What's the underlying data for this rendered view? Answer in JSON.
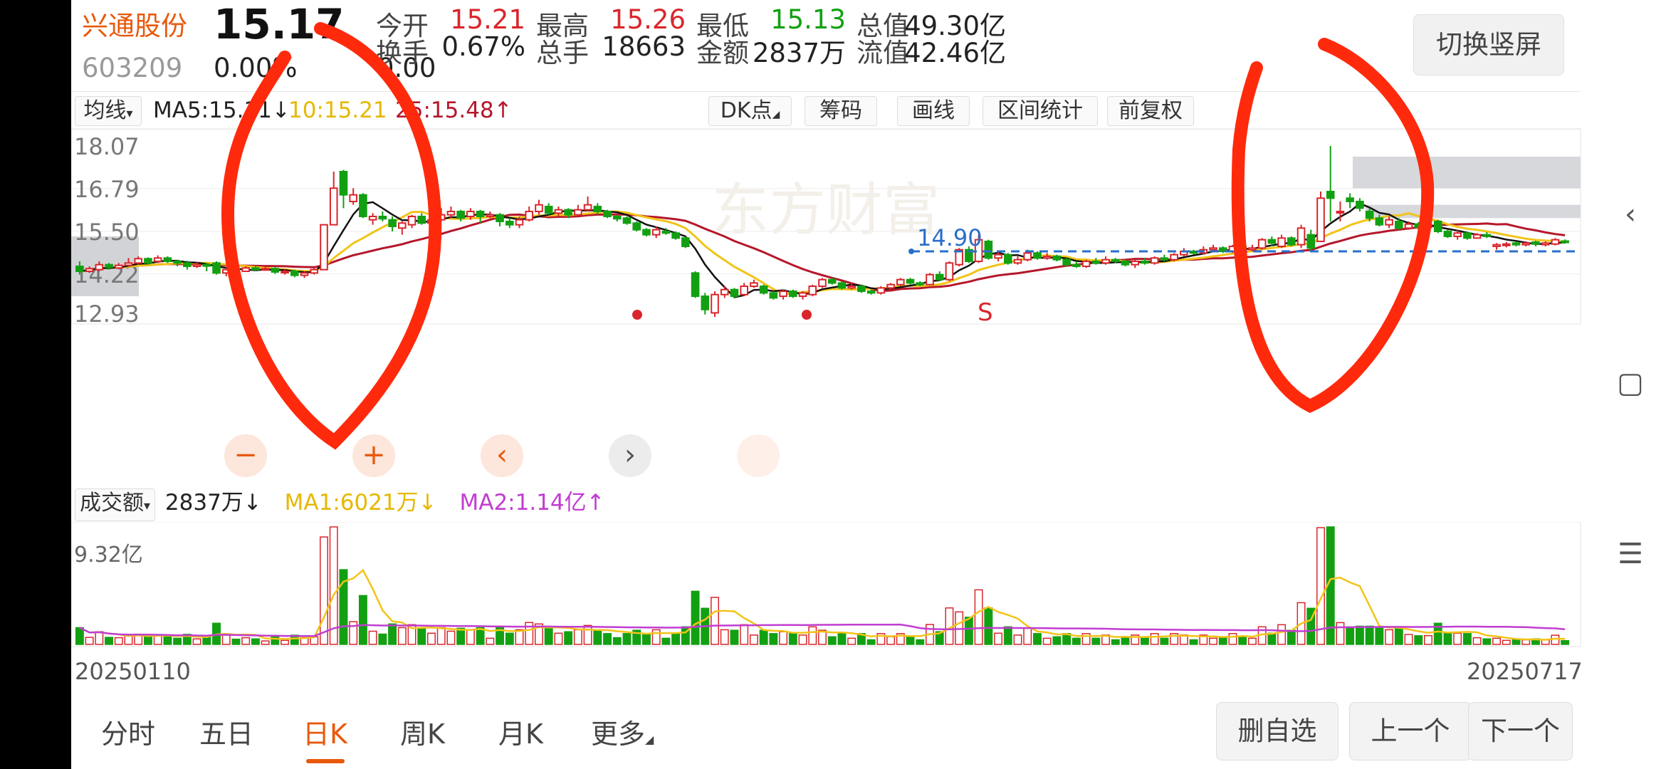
{
  "quote": {
    "name": "兴通股份",
    "price": "15.17",
    "code": "603209",
    "change_pct": "0.00%",
    "change_amt": "0.00",
    "stats": [
      {
        "label": "今开",
        "value": "15.21",
        "color": "#d9262c"
      },
      {
        "label": "最高",
        "value": "15.26",
        "color": "#d9262c"
      },
      {
        "label": "最低",
        "value": "15.13",
        "color": "#12a012"
      },
      {
        "label": "总值",
        "value": "49.30亿",
        "color": "#222222"
      },
      {
        "label": "换手",
        "value": "0.67%",
        "color": "#222222"
      },
      {
        "label": "总手",
        "value": "18663",
        "color": "#222222"
      },
      {
        "label": "金额",
        "value": "2837万",
        "color": "#222222"
      },
      {
        "label": "流值",
        "value": "42.46亿",
        "color": "#222222"
      }
    ],
    "switch_label": "切换竖屏"
  },
  "toolbar": {
    "ma_selector": "均线",
    "ma5": "MA5:15.11↓",
    "ma10": "10:15.21",
    "ma20": "25:15.48↑",
    "buttons": [
      "DK点",
      "筹码",
      "画线",
      "区间统计",
      "前复权"
    ]
  },
  "kchart": {
    "y_labels": [
      "18.07",
      "16.79",
      "15.50",
      "14.22",
      "12.93"
    ],
    "support_line_label": "14.90",
    "signal_label": "S",
    "watermark": "东方财富"
  },
  "volume": {
    "selector": "成交额",
    "amount": "2837万↓",
    "ma1": "MA1:6021万↓",
    "ma2": "MA2:1.14亿↑",
    "max_label": "9.32亿",
    "date_start": "20250110",
    "date_end": "20250717"
  },
  "controls": [
    "−",
    "+",
    "‹",
    "›"
  ],
  "tabs": [
    "分时",
    "五日",
    "日K",
    "周K",
    "月K",
    "更多"
  ],
  "active_tab": "日K",
  "bottom_buttons": [
    "删自选",
    "上一个",
    "下一个"
  ],
  "colors": {
    "up": "#d9262c",
    "down": "#12a012",
    "accent": "#e8590c",
    "ma_black": "#111111",
    "ma_yellow": "#f2c418",
    "ma_red": "#b5172b",
    "ma_magenta": "#c13dd1"
  },
  "chart_data": {
    "type": "candlestick",
    "y_range": [
      12.93,
      18.07
    ],
    "candles": [
      {
        "o": 14.45,
        "c": 14.3,
        "h": 14.6,
        "l": 14.2
      },
      {
        "o": 14.3,
        "c": 14.38,
        "h": 14.45,
        "l": 14.25
      },
      {
        "o": 14.35,
        "c": 14.5,
        "h": 14.6,
        "l": 14.3
      },
      {
        "o": 14.5,
        "c": 14.42,
        "h": 14.55,
        "l": 14.35
      },
      {
        "o": 14.4,
        "c": 14.48,
        "h": 14.55,
        "l": 14.36
      },
      {
        "o": 14.48,
        "c": 14.55,
        "h": 14.7,
        "l": 14.45
      },
      {
        "o": 14.55,
        "c": 14.68,
        "h": 14.75,
        "l": 14.5
      },
      {
        "o": 14.68,
        "c": 14.55,
        "h": 14.72,
        "l": 14.5
      },
      {
        "o": 14.6,
        "c": 14.7,
        "h": 14.78,
        "l": 14.55
      },
      {
        "o": 14.7,
        "c": 14.6,
        "h": 14.75,
        "l": 14.55
      },
      {
        "o": 14.6,
        "c": 14.55,
        "h": 14.65,
        "l": 14.45
      },
      {
        "o": 14.55,
        "c": 14.45,
        "h": 14.62,
        "l": 14.35
      },
      {
        "o": 14.45,
        "c": 14.5,
        "h": 14.58,
        "l": 14.4
      },
      {
        "o": 14.5,
        "c": 14.48,
        "h": 14.55,
        "l": 14.3
      },
      {
        "o": 14.55,
        "c": 14.25,
        "h": 14.6,
        "l": 14.2
      },
      {
        "o": 14.25,
        "c": 14.35,
        "h": 14.4,
        "l": 14.15
      },
      {
        "o": 14.35,
        "c": 14.3,
        "h": 14.42,
        "l": 14.25
      },
      {
        "o": 14.3,
        "c": 14.4,
        "h": 14.45,
        "l": 14.28
      },
      {
        "o": 14.4,
        "c": 14.35,
        "h": 14.48,
        "l": 14.3
      },
      {
        "o": 14.35,
        "c": 14.38,
        "h": 14.45,
        "l": 14.32
      },
      {
        "o": 14.38,
        "c": 14.28,
        "h": 14.42,
        "l": 14.22
      },
      {
        "o": 14.28,
        "c": 14.3,
        "h": 14.36,
        "l": 14.2
      },
      {
        "o": 14.3,
        "c": 14.18,
        "h": 14.35,
        "l": 14.12
      },
      {
        "o": 14.18,
        "c": 14.25,
        "h": 14.3,
        "l": 14.1
      },
      {
        "o": 14.25,
        "c": 14.35,
        "h": 14.4,
        "l": 14.2
      },
      {
        "o": 14.35,
        "c": 15.7,
        "h": 15.7,
        "l": 14.35
      },
      {
        "o": 15.7,
        "c": 16.8,
        "h": 17.3,
        "l": 15.7
      },
      {
        "o": 17.3,
        "c": 16.6,
        "h": 17.35,
        "l": 16.2
      },
      {
        "o": 16.4,
        "c": 16.6,
        "h": 16.8,
        "l": 16.3
      },
      {
        "o": 16.6,
        "c": 15.95,
        "h": 16.65,
        "l": 15.9
      },
      {
        "o": 15.85,
        "c": 15.95,
        "h": 16.05,
        "l": 15.7
      },
      {
        "o": 15.95,
        "c": 15.88,
        "h": 16.1,
        "l": 15.8
      },
      {
        "o": 15.85,
        "c": 15.65,
        "h": 15.95,
        "l": 15.5
      },
      {
        "o": 15.6,
        "c": 15.75,
        "h": 15.8,
        "l": 15.4
      },
      {
        "o": 15.7,
        "c": 15.95,
        "h": 16.0,
        "l": 15.6
      },
      {
        "o": 15.95,
        "c": 15.75,
        "h": 16.05,
        "l": 15.7
      },
      {
        "o": 15.75,
        "c": 15.85,
        "h": 16.0,
        "l": 15.7
      },
      {
        "o": 15.85,
        "c": 16.0,
        "h": 16.2,
        "l": 15.8
      },
      {
        "o": 16.0,
        "c": 16.1,
        "h": 16.25,
        "l": 15.9
      },
      {
        "o": 16.1,
        "c": 15.9,
        "h": 16.15,
        "l": 15.8
      },
      {
        "o": 15.95,
        "c": 16.1,
        "h": 16.2,
        "l": 15.85
      },
      {
        "o": 16.1,
        "c": 15.95,
        "h": 16.15,
        "l": 15.75
      },
      {
        "o": 15.95,
        "c": 16.0,
        "h": 16.1,
        "l": 15.9
      },
      {
        "o": 16.0,
        "c": 15.8,
        "h": 16.05,
        "l": 15.65
      },
      {
        "o": 15.8,
        "c": 15.7,
        "h": 15.9,
        "l": 15.6
      },
      {
        "o": 15.7,
        "c": 15.85,
        "h": 15.95,
        "l": 15.6
      },
      {
        "o": 15.85,
        "c": 16.1,
        "h": 16.25,
        "l": 15.8
      },
      {
        "o": 16.1,
        "c": 16.3,
        "h": 16.45,
        "l": 16.0
      },
      {
        "o": 16.25,
        "c": 16.05,
        "h": 16.35,
        "l": 16.0
      },
      {
        "o": 16.05,
        "c": 16.15,
        "h": 16.25,
        "l": 15.95
      },
      {
        "o": 16.15,
        "c": 16.0,
        "h": 16.2,
        "l": 15.9
      },
      {
        "o": 16.0,
        "c": 16.15,
        "h": 16.3,
        "l": 15.95
      },
      {
        "o": 16.15,
        "c": 16.3,
        "h": 16.55,
        "l": 16.1
      },
      {
        "o": 16.25,
        "c": 16.1,
        "h": 16.35,
        "l": 16.0
      },
      {
        "o": 16.1,
        "c": 15.95,
        "h": 16.15,
        "l": 15.9
      },
      {
        "o": 15.95,
        "c": 15.88,
        "h": 16.0,
        "l": 15.8
      },
      {
        "o": 15.9,
        "c": 15.75,
        "h": 15.95,
        "l": 15.7
      },
      {
        "o": 15.75,
        "c": 15.55,
        "h": 15.8,
        "l": 15.5
      },
      {
        "o": 15.55,
        "c": 15.4,
        "h": 15.6,
        "l": 15.35
      },
      {
        "o": 15.4,
        "c": 15.55,
        "h": 15.65,
        "l": 15.3
      },
      {
        "o": 15.5,
        "c": 15.45,
        "h": 15.6,
        "l": 15.4
      },
      {
        "o": 15.45,
        "c": 15.3,
        "h": 15.5,
        "l": 15.25
      },
      {
        "o": 15.3,
        "c": 15.05,
        "h": 15.35,
        "l": 15.0
      },
      {
        "o": 14.25,
        "c": 13.55,
        "h": 14.3,
        "l": 13.5
      },
      {
        "o": 13.55,
        "c": 13.15,
        "h": 13.65,
        "l": 13.0
      },
      {
        "o": 13.05,
        "c": 13.6,
        "h": 13.7,
        "l": 12.93
      },
      {
        "o": 13.6,
        "c": 13.75,
        "h": 13.85,
        "l": 13.5
      },
      {
        "o": 13.75,
        "c": 13.55,
        "h": 13.8,
        "l": 13.5
      },
      {
        "o": 13.6,
        "c": 13.85,
        "h": 13.95,
        "l": 13.55
      },
      {
        "o": 13.85,
        "c": 13.95,
        "h": 14.05,
        "l": 13.8
      },
      {
        "o": 13.85,
        "c": 13.65,
        "h": 13.9,
        "l": 13.6
      },
      {
        "o": 13.65,
        "c": 13.5,
        "h": 13.7,
        "l": 13.45
      },
      {
        "o": 13.55,
        "c": 13.7,
        "h": 13.75,
        "l": 13.45
      },
      {
        "o": 13.7,
        "c": 13.55,
        "h": 13.75,
        "l": 13.5
      },
      {
        "o": 13.55,
        "c": 13.65,
        "h": 13.7,
        "l": 13.45
      },
      {
        "o": 13.6,
        "c": 13.85,
        "h": 13.9,
        "l": 13.55
      },
      {
        "o": 13.85,
        "c": 14.05,
        "h": 14.1,
        "l": 13.8
      },
      {
        "o": 14.05,
        "c": 13.95,
        "h": 14.1,
        "l": 13.9
      },
      {
        "o": 13.95,
        "c": 13.8,
        "h": 14.0,
        "l": 13.75
      },
      {
        "o": 13.8,
        "c": 13.85,
        "h": 13.95,
        "l": 13.75
      },
      {
        "o": 13.85,
        "c": 13.7,
        "h": 13.9,
        "l": 13.65
      },
      {
        "o": 13.7,
        "c": 13.65,
        "h": 13.75,
        "l": 13.6
      },
      {
        "o": 13.65,
        "c": 13.8,
        "h": 13.85,
        "l": 13.6
      },
      {
        "o": 13.8,
        "c": 13.9,
        "h": 13.95,
        "l": 13.75
      },
      {
        "o": 13.9,
        "c": 14.05,
        "h": 14.1,
        "l": 13.85
      },
      {
        "o": 14.05,
        "c": 13.95,
        "h": 14.1,
        "l": 13.9
      },
      {
        "o": 13.95,
        "c": 13.9,
        "h": 14.0,
        "l": 13.85
      },
      {
        "o": 13.9,
        "c": 14.2,
        "h": 14.25,
        "l": 13.88
      },
      {
        "o": 14.2,
        "c": 14.05,
        "h": 14.3,
        "l": 14.0
      },
      {
        "o": 14.05,
        "c": 14.55,
        "h": 14.6,
        "l": 14.0
      },
      {
        "o": 14.5,
        "c": 14.95,
        "h": 15.0,
        "l": 14.45
      },
      {
        "o": 14.95,
        "c": 14.6,
        "h": 15.05,
        "l": 14.55
      },
      {
        "o": 14.6,
        "c": 15.25,
        "h": 15.4,
        "l": 14.55
      },
      {
        "o": 15.2,
        "c": 14.7,
        "h": 15.25,
        "l": 14.65
      },
      {
        "o": 14.7,
        "c": 14.8,
        "h": 14.9,
        "l": 14.6
      },
      {
        "o": 14.8,
        "c": 14.55,
        "h": 14.85,
        "l": 14.5
      },
      {
        "o": 14.55,
        "c": 14.65,
        "h": 14.75,
        "l": 14.5
      },
      {
        "o": 14.65,
        "c": 14.85,
        "h": 14.95,
        "l": 14.6
      },
      {
        "o": 14.85,
        "c": 14.7,
        "h": 14.9,
        "l": 14.65
      },
      {
        "o": 14.7,
        "c": 14.75,
        "h": 14.85,
        "l": 14.65
      },
      {
        "o": 14.75,
        "c": 14.65,
        "h": 14.8,
        "l": 14.6
      },
      {
        "o": 14.65,
        "c": 14.5,
        "h": 14.7,
        "l": 14.45
      },
      {
        "o": 14.5,
        "c": 14.45,
        "h": 14.6,
        "l": 14.4
      },
      {
        "o": 14.45,
        "c": 14.6,
        "h": 14.65,
        "l": 14.4
      },
      {
        "o": 14.6,
        "c": 14.55,
        "h": 14.7,
        "l": 14.5
      },
      {
        "o": 14.55,
        "c": 14.65,
        "h": 14.75,
        "l": 14.5
      },
      {
        "o": 14.65,
        "c": 14.6,
        "h": 14.7,
        "l": 14.55
      },
      {
        "o": 14.6,
        "c": 14.5,
        "h": 14.65,
        "l": 14.45
      },
      {
        "o": 14.5,
        "c": 14.6,
        "h": 14.65,
        "l": 14.4
      },
      {
        "o": 14.6,
        "c": 14.55,
        "h": 14.7,
        "l": 14.5
      },
      {
        "o": 14.55,
        "c": 14.7,
        "h": 14.75,
        "l": 14.5
      },
      {
        "o": 14.7,
        "c": 14.65,
        "h": 14.8,
        "l": 14.6
      },
      {
        "o": 14.65,
        "c": 14.8,
        "h": 14.85,
        "l": 14.6
      },
      {
        "o": 14.8,
        "c": 14.9,
        "h": 15.0,
        "l": 14.75
      },
      {
        "o": 14.9,
        "c": 14.85,
        "h": 14.95,
        "l": 14.8
      },
      {
        "o": 14.85,
        "c": 14.95,
        "h": 15.05,
        "l": 14.8
      },
      {
        "o": 14.95,
        "c": 15.0,
        "h": 15.1,
        "l": 14.9
      },
      {
        "o": 15.0,
        "c": 14.9,
        "h": 15.05,
        "l": 14.85
      },
      {
        "o": 14.9,
        "c": 15.05,
        "h": 15.1,
        "l": 14.85
      },
      {
        "o": 15.05,
        "c": 14.95,
        "h": 15.1,
        "l": 14.9
      },
      {
        "o": 14.95,
        "c": 15.0,
        "h": 15.1,
        "l": 14.9
      },
      {
        "o": 15.0,
        "c": 15.25,
        "h": 15.3,
        "l": 14.95
      },
      {
        "o": 15.25,
        "c": 15.15,
        "h": 15.35,
        "l": 15.05
      },
      {
        "o": 15.05,
        "c": 15.3,
        "h": 15.4,
        "l": 15.0
      },
      {
        "o": 15.3,
        "c": 15.1,
        "h": 15.35,
        "l": 15.05
      },
      {
        "o": 15.1,
        "c": 15.6,
        "h": 15.7,
        "l": 15.0
      },
      {
        "o": 15.4,
        "c": 15.0,
        "h": 15.55,
        "l": 14.9
      },
      {
        "o": 15.2,
        "c": 16.5,
        "h": 16.7,
        "l": 15.2
      },
      {
        "o": 16.7,
        "c": 16.5,
        "h": 18.07,
        "l": 15.8
      },
      {
        "o": 16.1,
        "c": 16.1,
        "h": 16.4,
        "l": 15.8
      },
      {
        "o": 16.5,
        "c": 16.4,
        "h": 16.65,
        "l": 16.2
      },
      {
        "o": 16.4,
        "c": 16.2,
        "h": 16.5,
        "l": 16.1
      },
      {
        "o": 16.1,
        "c": 15.9,
        "h": 16.2,
        "l": 15.8
      },
      {
        "o": 15.9,
        "c": 15.7,
        "h": 16.0,
        "l": 15.65
      },
      {
        "o": 15.7,
        "c": 15.85,
        "h": 15.95,
        "l": 15.6
      },
      {
        "o": 15.8,
        "c": 15.6,
        "h": 15.9,
        "l": 15.55
      },
      {
        "o": 15.6,
        "c": 15.72,
        "h": 15.8,
        "l": 15.55
      },
      {
        "o": 15.72,
        "c": 15.62,
        "h": 15.78,
        "l": 15.55
      },
      {
        "o": 15.62,
        "c": 15.7,
        "h": 15.8,
        "l": 15.55
      },
      {
        "o": 15.8,
        "c": 15.5,
        "h": 15.85,
        "l": 15.45
      },
      {
        "o": 15.5,
        "c": 15.35,
        "h": 15.55,
        "l": 15.3
      },
      {
        "o": 15.35,
        "c": 15.45,
        "h": 15.55,
        "l": 15.25
      },
      {
        "o": 15.45,
        "c": 15.3,
        "h": 15.5,
        "l": 15.25
      },
      {
        "o": 15.3,
        "c": 15.4,
        "h": 15.45,
        "l": 15.28
      },
      {
        "o": 15.4,
        "c": 15.35,
        "h": 15.48,
        "l": 15.3
      },
      {
        "o": 15.05,
        "c": 15.1,
        "h": 15.15,
        "l": 14.95
      },
      {
        "o": 15.1,
        "c": 15.12,
        "h": 15.18,
        "l": 15.02
      },
      {
        "o": 15.15,
        "c": 15.1,
        "h": 15.2,
        "l": 15.05
      },
      {
        "o": 15.1,
        "c": 15.15,
        "h": 15.2,
        "l": 15.05
      },
      {
        "o": 15.18,
        "c": 15.12,
        "h": 15.22,
        "l": 15.05
      },
      {
        "o": 15.1,
        "c": 15.15,
        "h": 15.2,
        "l": 15.05
      },
      {
        "o": 15.12,
        "c": 15.25,
        "h": 15.3,
        "l": 15.08
      },
      {
        "o": 15.21,
        "c": 15.17,
        "h": 15.26,
        "l": 15.13
      }
    ],
    "volume_max_label": "9.32亿"
  }
}
